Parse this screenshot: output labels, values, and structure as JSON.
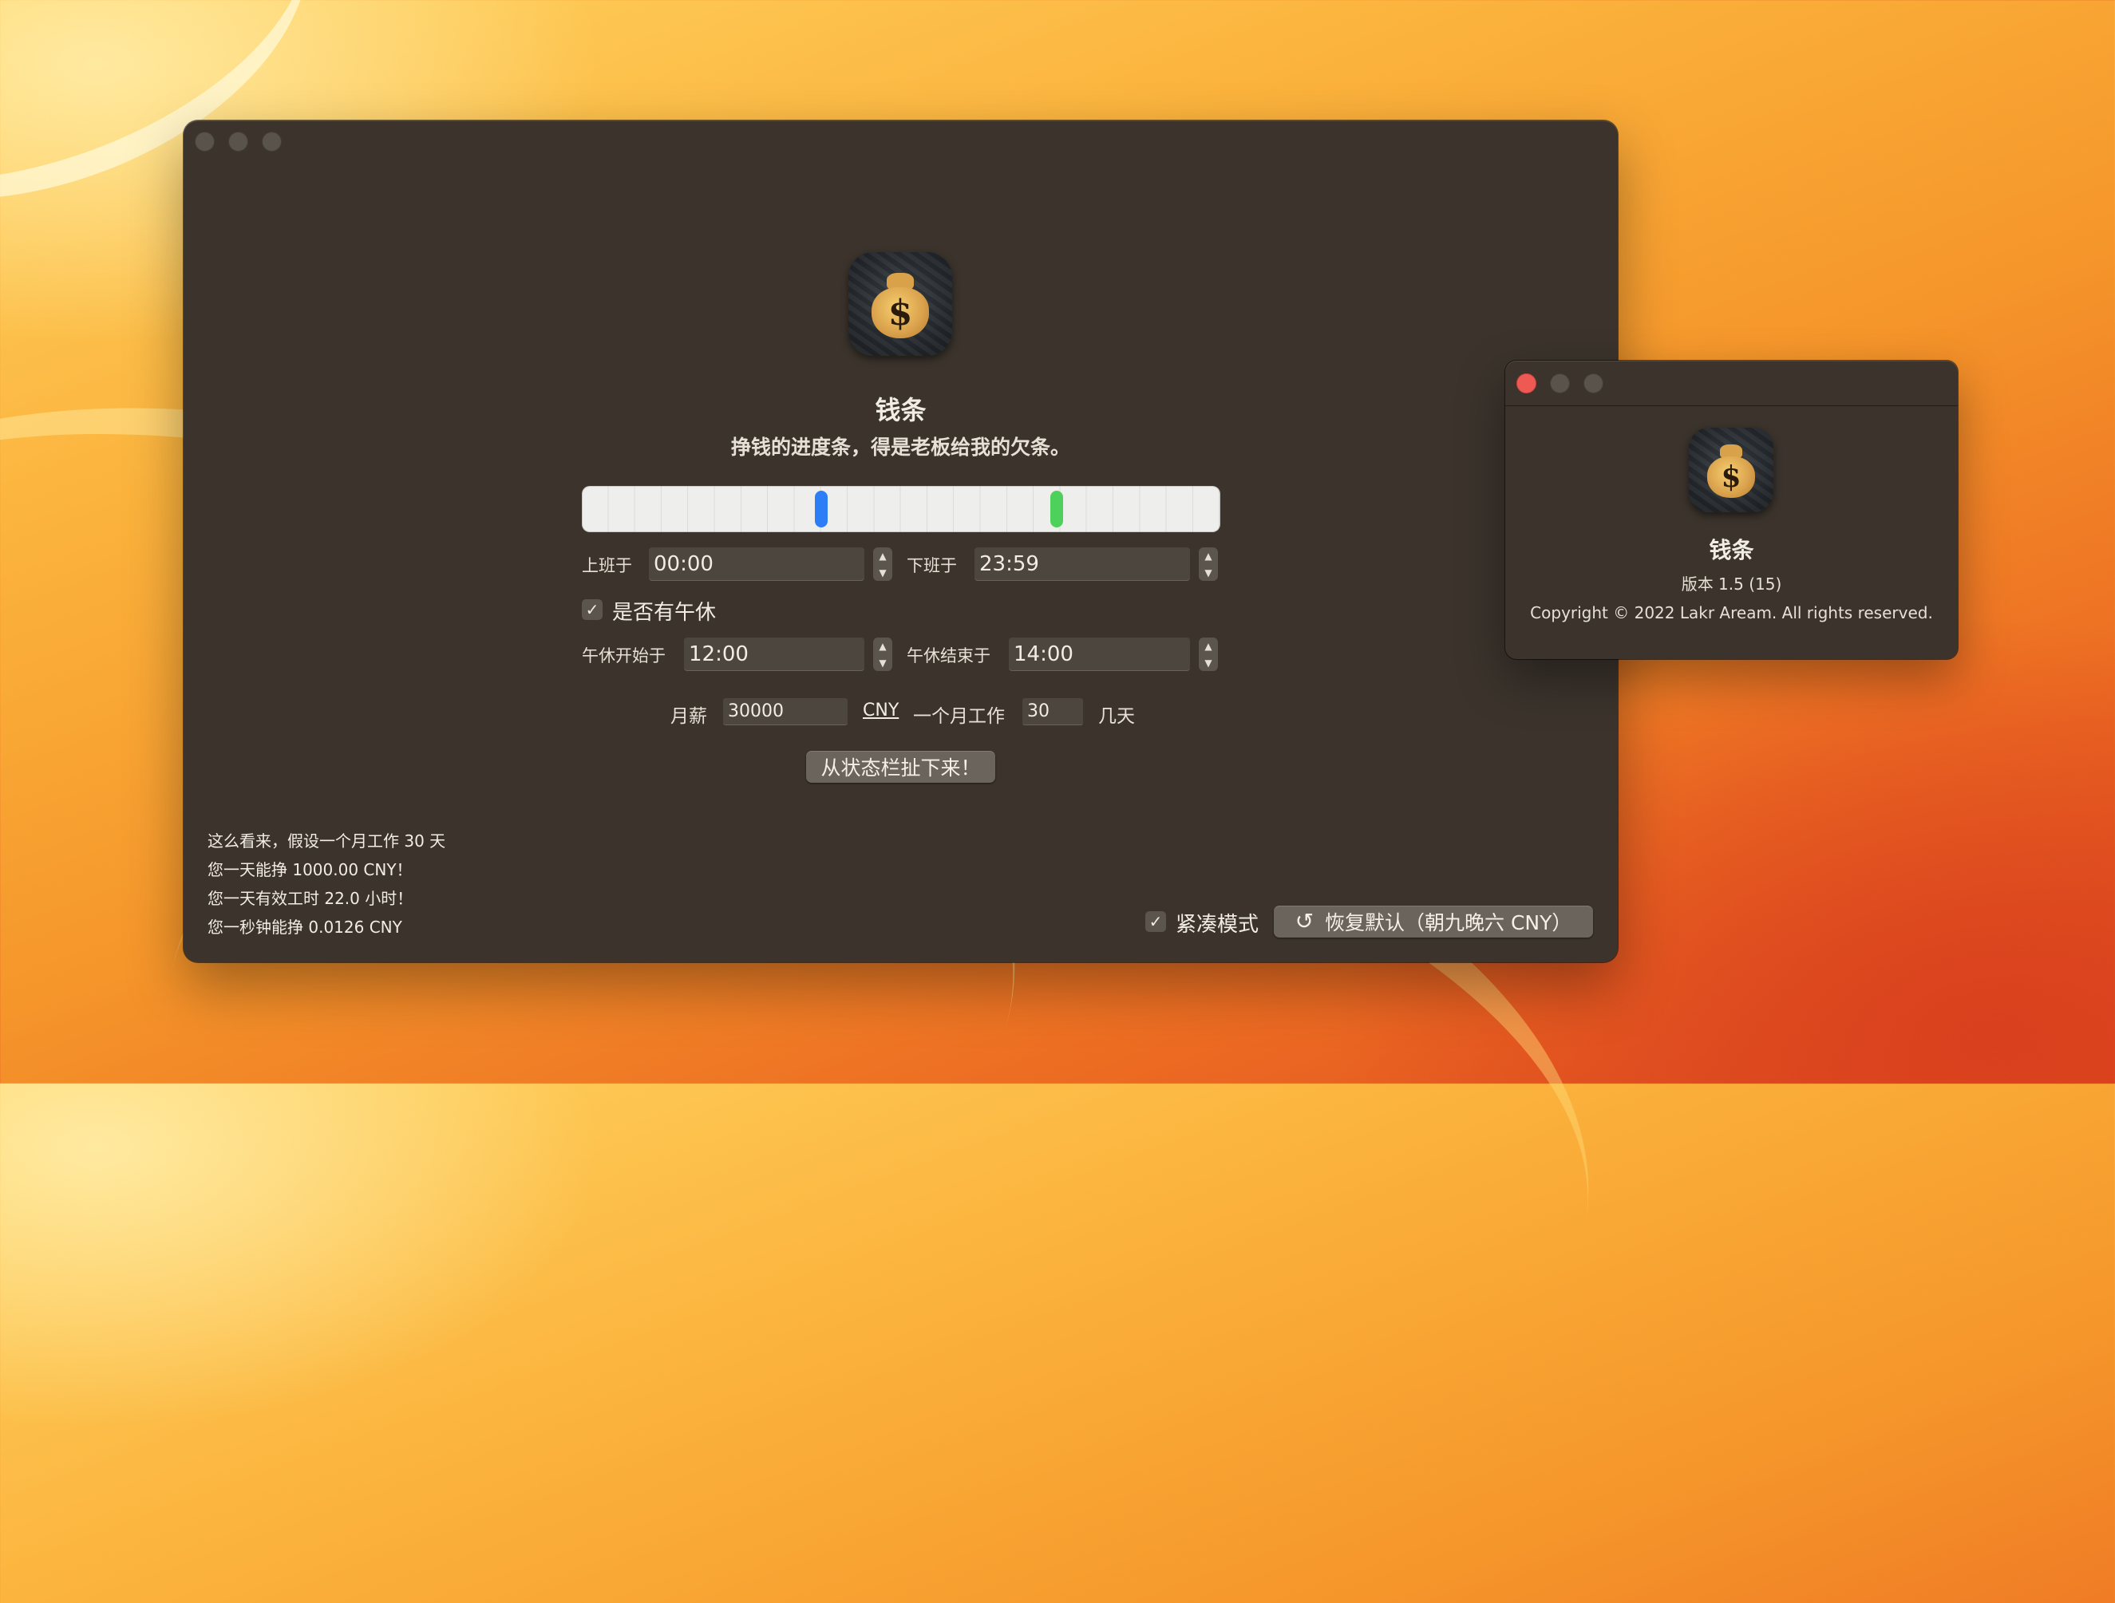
{
  "main": {
    "app_name": "钱条",
    "tagline": "挣钱的进度条，得是老板给我的欠条。",
    "work_start_label": "上班于",
    "work_start_value": "00:00",
    "work_end_label": "下班于",
    "work_end_value": "23:59",
    "lunch_checkbox_label": "是否有午休",
    "lunch_checked": true,
    "lunch_start_label": "午休开始于",
    "lunch_start_value": "12:00",
    "lunch_end_label": "午休结束于",
    "lunch_end_value": "14:00",
    "salary_label": "月薪",
    "salary_value": "30000",
    "currency": "CNY",
    "workdays_label": "一个月工作",
    "workdays_value": "30",
    "workdays_unit": "几天",
    "drag_button": "从状态栏扯下来！",
    "stats": [
      "这么看来，假设一个月工作 30 天",
      "您一天能挣 1000.00 CNY！",
      "您一天有效工时 22.0 小时！",
      "您一秒钟能挣 0.0126 CNY"
    ],
    "compact_label": "紧凑模式",
    "compact_checked": true,
    "reset_button": "恢复默认（朝九晚六 CNY）",
    "progress": {
      "blue_marker_fraction": 0.375,
      "green_marker_fraction": 0.744
    },
    "colors": {
      "blue_marker": "#2c7df6",
      "green_marker": "#4ed15a"
    }
  },
  "about": {
    "app_name": "钱条",
    "version": "版本 1.5 (15)",
    "copyright": "Copyright © 2022 Lakr Aream. All rights reserved."
  },
  "icons": {
    "app_icon": "money-bag-icon",
    "checkmark": "✓",
    "reset": "↺",
    "stepper_up": "▲",
    "stepper_down": "▼"
  }
}
